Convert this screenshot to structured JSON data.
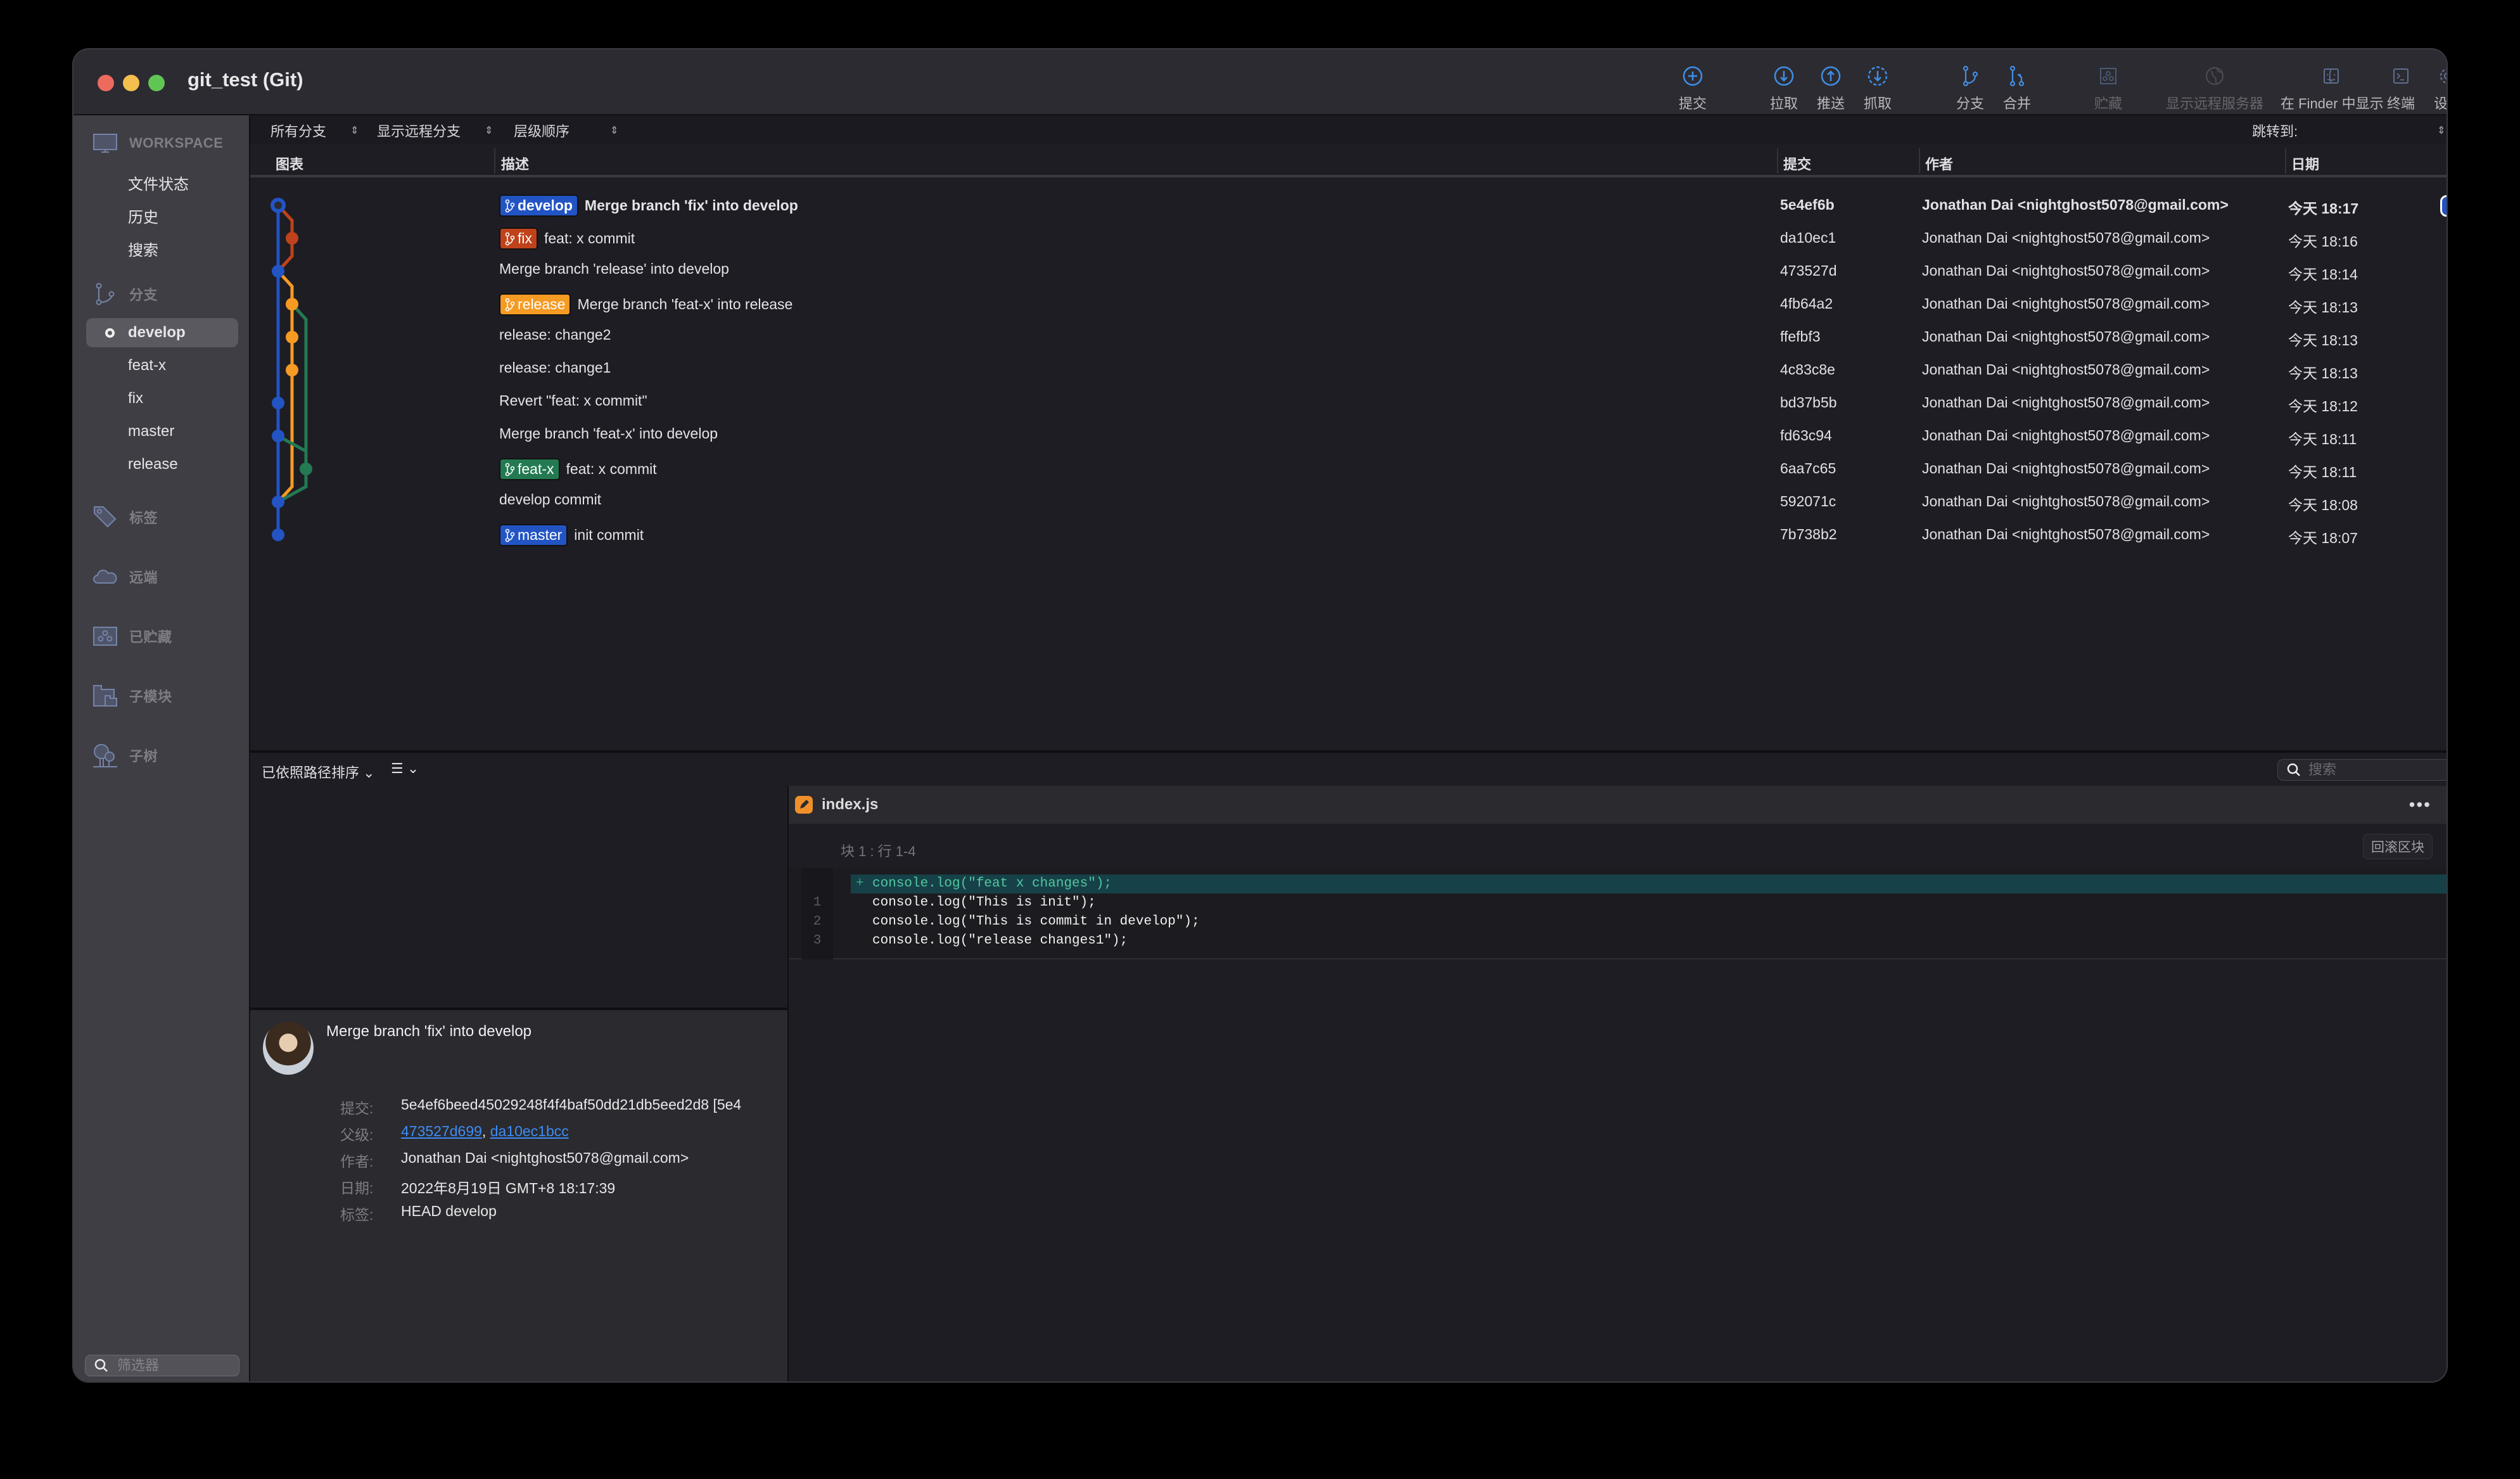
{
  "window": {
    "title": "git_test (Git)"
  },
  "toolbar": {
    "items": [
      {
        "id": "commit",
        "label": "提交",
        "icon": "plus-circle-icon",
        "enabled": true
      },
      {
        "id": "pull",
        "label": "拉取",
        "icon": "arrow-down-circle-icon",
        "enabled": true
      },
      {
        "id": "push",
        "label": "推送",
        "icon": "arrow-up-circle-icon",
        "enabled": true
      },
      {
        "id": "fetch",
        "label": "抓取",
        "icon": "dashed-arrow-down-circle-icon",
        "enabled": true
      },
      {
        "id": "branch",
        "label": "分支",
        "icon": "branch-icon",
        "enabled": true
      },
      {
        "id": "merge",
        "label": "合并",
        "icon": "merge-icon",
        "enabled": true
      },
      {
        "id": "stash",
        "label": "贮藏",
        "icon": "stash-icon",
        "enabled": false
      },
      {
        "id": "remote",
        "label": "显示远程服务器",
        "icon": "globe-icon",
        "enabled": false
      },
      {
        "id": "finder",
        "label": "在 Finder 中显示",
        "icon": "finder-icon",
        "enabled": true
      },
      {
        "id": "terminal",
        "label": "终端",
        "icon": "terminal-icon",
        "enabled": true
      },
      {
        "id": "settings",
        "label": "设置",
        "icon": "gear-icon",
        "enabled": true
      }
    ]
  },
  "sidebar": {
    "workspace": {
      "label": "WORKSPACE",
      "items": [
        "文件状态",
        "历史",
        "搜索"
      ]
    },
    "branches": {
      "label": "分支",
      "items": [
        {
          "name": "develop",
          "current": true
        },
        {
          "name": "feat-x",
          "current": false
        },
        {
          "name": "fix",
          "current": false
        },
        {
          "name": "master",
          "current": false
        },
        {
          "name": "release",
          "current": false
        }
      ]
    },
    "tags_label": "标签",
    "remotes_label": "远端",
    "stashes_label": "已贮藏",
    "submodules_label": "子模块",
    "subtrees_label": "子树",
    "filter_placeholder": "筛选器"
  },
  "filters": {
    "branches": "所有分支",
    "remote": "显示远程分支",
    "order": "层级顺序",
    "jump_to": "跳转到:"
  },
  "columns": {
    "graph": "图表",
    "description": "描述",
    "commit": "提交",
    "author": "作者",
    "date": "日期"
  },
  "branch_colors": {
    "develop": "#2254c4",
    "fix": "#c0421a",
    "release": "#f59a23",
    "feat-x": "#237a52",
    "master": "#2254c4"
  },
  "commits": [
    {
      "badge": "develop",
      "message": "Merge branch 'fix' into develop",
      "hash": "5e4ef6b",
      "author": "Jonathan Dai <nightghost5078@gmail.com>",
      "date": "今天 18:17",
      "selected": true
    },
    {
      "badge": "fix",
      "message": "feat: x commit",
      "hash": "da10ec1",
      "author": "Jonathan Dai <nightghost5078@gmail.com>",
      "date": "今天 18:16"
    },
    {
      "badge": null,
      "message": "Merge branch 'release' into develop",
      "hash": "473527d",
      "author": "Jonathan Dai <nightghost5078@gmail.com>",
      "date": "今天 18:14"
    },
    {
      "badge": "release",
      "message": "Merge branch 'feat-x' into release",
      "hash": "4fb64a2",
      "author": "Jonathan Dai <nightghost5078@gmail.com>",
      "date": "今天 18:13"
    },
    {
      "badge": null,
      "message": "release: change2",
      "hash": "ffefbf3",
      "author": "Jonathan Dai <nightghost5078@gmail.com>",
      "date": "今天 18:13"
    },
    {
      "badge": null,
      "message": "release: change1",
      "hash": "4c83c8e",
      "author": "Jonathan Dai <nightghost5078@gmail.com>",
      "date": "今天 18:13"
    },
    {
      "badge": null,
      "message": "Revert \"feat: x commit\"",
      "hash": "bd37b5b",
      "author": "Jonathan Dai <nightghost5078@gmail.com>",
      "date": "今天 18:12"
    },
    {
      "badge": null,
      "message": "Merge branch 'feat-x' into develop",
      "hash": "fd63c94",
      "author": "Jonathan Dai <nightghost5078@gmail.com>",
      "date": "今天 18:11"
    },
    {
      "badge": "feat-x",
      "message": "feat: x commit",
      "hash": "6aa7c65",
      "author": "Jonathan Dai <nightghost5078@gmail.com>",
      "date": "今天 18:11"
    },
    {
      "badge": null,
      "message": "develop commit",
      "hash": "592071c",
      "author": "Jonathan Dai <nightghost5078@gmail.com>",
      "date": "今天 18:08"
    },
    {
      "badge": "master",
      "message": "init commit",
      "hash": "7b738b2",
      "author": "Jonathan Dai <nightghost5078@gmail.com>",
      "date": "今天 18:07"
    }
  ],
  "graph": {
    "nodes": [
      {
        "row": 0,
        "lane": 0,
        "color": "develop",
        "head": true
      },
      {
        "row": 1,
        "lane": 1,
        "color": "fix"
      },
      {
        "row": 2,
        "lane": 0,
        "color": "develop"
      },
      {
        "row": 3,
        "lane": 1,
        "color": "release"
      },
      {
        "row": 4,
        "lane": 1,
        "color": "release"
      },
      {
        "row": 5,
        "lane": 1,
        "color": "release"
      },
      {
        "row": 6,
        "lane": 0,
        "color": "develop"
      },
      {
        "row": 7,
        "lane": 0,
        "color": "develop"
      },
      {
        "row": 8,
        "lane": 2,
        "color": "feat-x"
      },
      {
        "row": 9,
        "lane": 0,
        "color": "develop"
      },
      {
        "row": 10,
        "lane": 0,
        "color": "develop"
      }
    ],
    "edges": [
      {
        "from": [
          0,
          0
        ],
        "to": [
          10,
          0
        ],
        "color": "develop"
      },
      {
        "from": [
          0,
          0
        ],
        "to": [
          1,
          1
        ],
        "color": "fix"
      },
      {
        "from": [
          1,
          1
        ],
        "to": [
          2,
          0
        ],
        "color": "fix"
      },
      {
        "from": [
          2,
          0
        ],
        "to": [
          3,
          1
        ],
        "color": "release"
      },
      {
        "from": [
          3,
          1
        ],
        "to": [
          9,
          0
        ],
        "color": "release"
      },
      {
        "from": [
          3,
          1
        ],
        "to": [
          4,
          2
        ],
        "color": "feat-x"
      },
      {
        "from": [
          4,
          2
        ],
        "to": [
          8,
          2
        ],
        "color": "feat-x"
      },
      {
        "from": [
          7,
          0
        ],
        "to": [
          8,
          2
        ],
        "color": "feat-x"
      },
      {
        "from": [
          8,
          2
        ],
        "to": [
          9,
          0
        ],
        "color": "feat-x"
      }
    ]
  },
  "lower": {
    "sort_label": "已依照路径排序",
    "view_icon": "list-icon",
    "search_placeholder": "搜索"
  },
  "details": {
    "subject": "Merge branch 'fix' into develop",
    "commit_label": "提交:",
    "commit_value": "5e4ef6beed45029248f4f4baf50dd21db5eed2d8 [5e4",
    "parents_label": "父级:",
    "parents": [
      "473527d699",
      "da10ec1bcc"
    ],
    "author_label": "作者:",
    "author_value": "Jonathan Dai <nightghost5078@gmail.com>",
    "date_label": "日期:",
    "date_value": "2022年8月19日 GMT+8 18:17:39",
    "tags_label": "标签:",
    "tags_value": "HEAD develop"
  },
  "diff": {
    "file_name": "index.js",
    "hunk_label": "块 1 :  行 1-4",
    "revert_label": "回滚区块",
    "lines": [
      {
        "type": "added",
        "ln": "",
        "text": "console.log(\"feat x changes\");"
      },
      {
        "type": "context",
        "ln": "1",
        "text": "console.log(\"This is init\");"
      },
      {
        "type": "context",
        "ln": "2",
        "text": "console.log(\"This is commit in develop\");"
      },
      {
        "type": "context",
        "ln": "3",
        "text": "console.log(\"release changes1\");"
      }
    ]
  }
}
